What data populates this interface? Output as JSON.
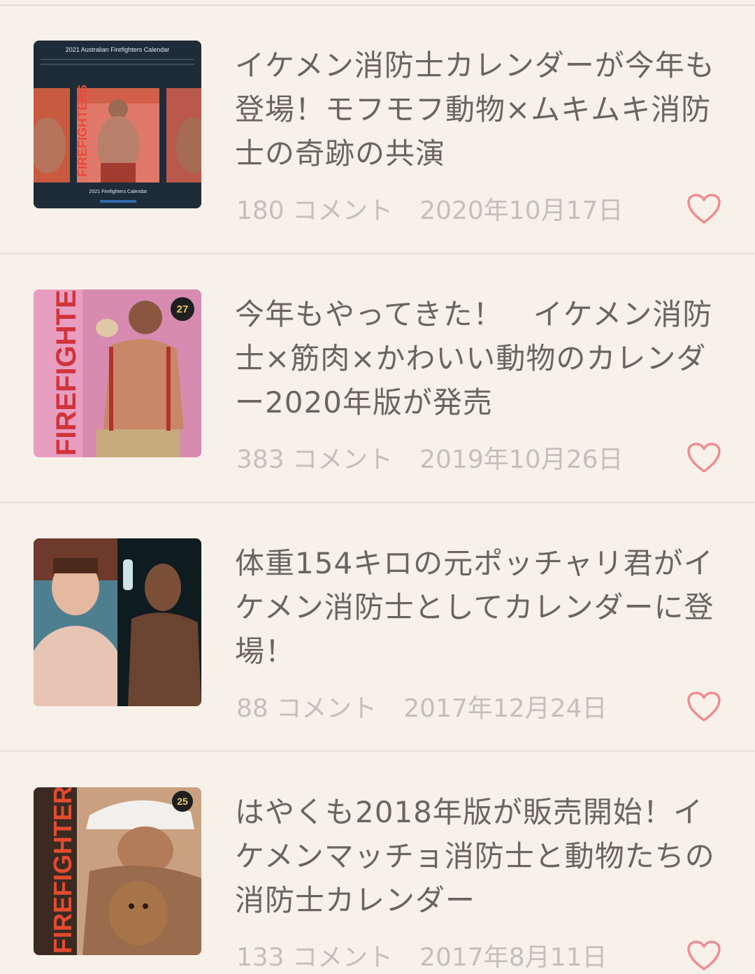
{
  "articles": [
    {
      "title": "イケメン消防士カレンダーが今年も登場！モフモフ動物×ムキムキ消防士の奇跡の共演",
      "comments": "180 コメント",
      "date": "2020年10月17日",
      "thumb_caption_top": "2021 Australian Firefighters Calendar",
      "thumb_word": "FIREFIGHTERS",
      "thumb_caption_bottom": "2021 Firefighters Calendar"
    },
    {
      "title": "今年もやってきた！　イケメン消防士×筋肉×かわいい動物のカレンダー2020年版が発売",
      "comments": "383 コメント",
      "date": "2019年10月26日",
      "thumb_word": "FIREFIGHTERS",
      "thumb_badge": "27"
    },
    {
      "title": "体重154キロの元ポッチャリ君がイケメン消防士としてカレンダーに登場！",
      "comments": "88 コメント",
      "date": "2017年12月24日"
    },
    {
      "title": "はやくも2018年版が販売開始！イケメンマッチョ消防士と動物たちの消防士カレンダー",
      "comments": "133 コメント",
      "date": "2017年8月11日",
      "thumb_word": "FIREFIGHTERS",
      "thumb_badge": "25"
    }
  ],
  "colors": {
    "background": "#f8f1ea",
    "title": "#6b6460",
    "meta": "#c5bfbb",
    "heart": "#ee8d93"
  }
}
